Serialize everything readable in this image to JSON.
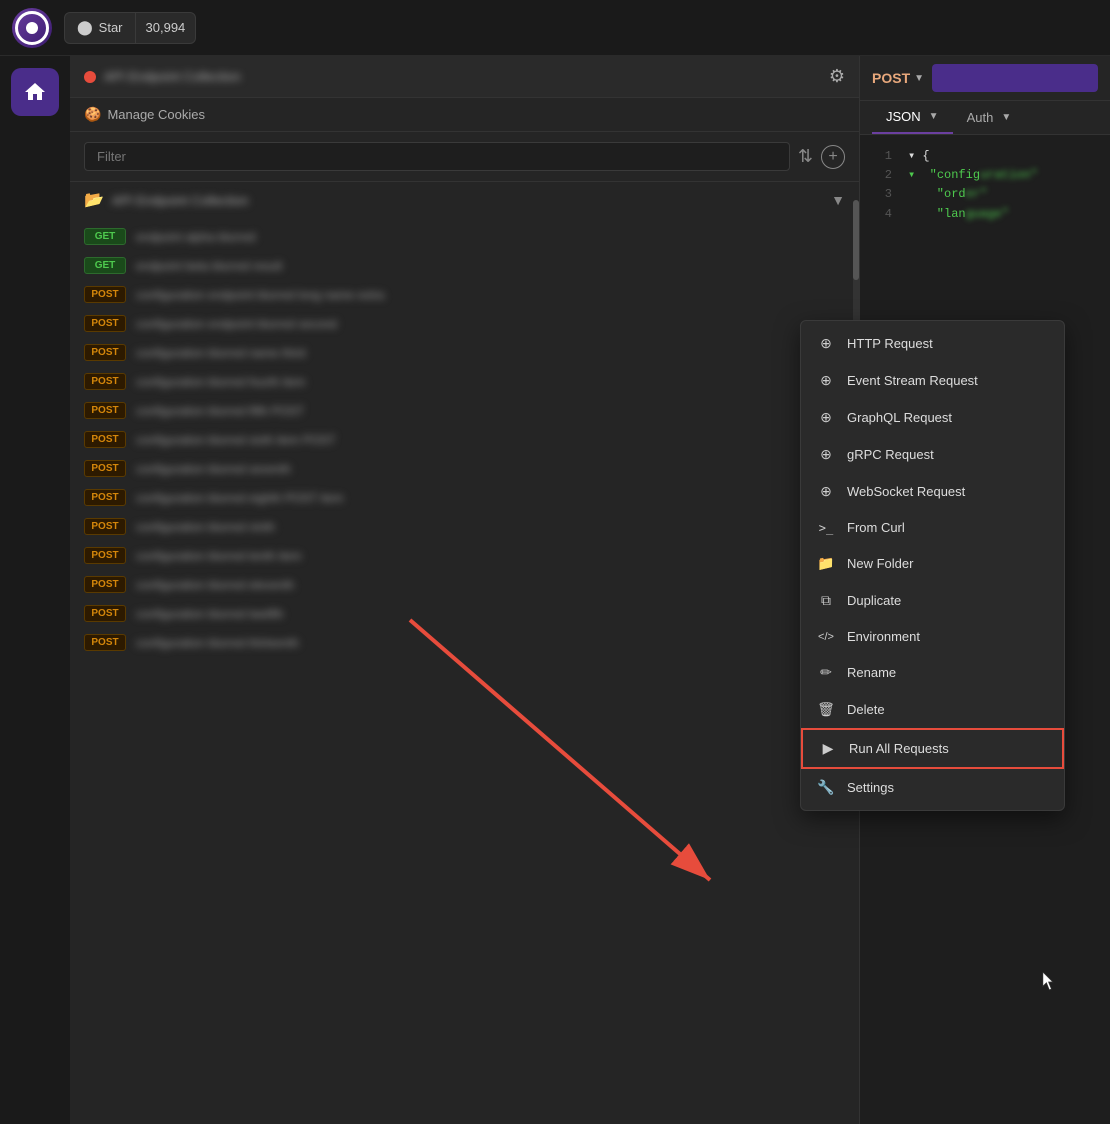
{
  "topbar": {
    "star_label": "Star",
    "star_count": "30,994",
    "github_icon": "github"
  },
  "request_panel": {
    "record_dot": "red",
    "title": "API Endpoint Collection",
    "filter_placeholder": "Filter",
    "manage_cookies": "Manage Cookies",
    "collection_name": "API Endpoint Collection"
  },
  "methods": {
    "get": "GET",
    "post": "POST"
  },
  "right_panel": {
    "method": "POST",
    "tab_json": "JSON",
    "tab_auth": "Auth"
  },
  "dropdown_menu": {
    "items": [
      {
        "id": "http-request",
        "icon": "⊕",
        "label": "HTTP Request"
      },
      {
        "id": "event-stream-request",
        "icon": "⊕",
        "label": "Event Stream Request"
      },
      {
        "id": "graphql-request",
        "icon": "⊕",
        "label": "GraphQL Request"
      },
      {
        "id": "grpc-request",
        "icon": "⊕",
        "label": "gRPC Request"
      },
      {
        "id": "websocket-request",
        "icon": "⊕",
        "label": "WebSocket Request"
      },
      {
        "id": "from-curl",
        "icon": ">_",
        "label": "From Curl"
      },
      {
        "id": "new-folder",
        "icon": "📁",
        "label": "New Folder"
      },
      {
        "id": "duplicate",
        "icon": "⧉",
        "label": "Duplicate"
      },
      {
        "id": "environment",
        "icon": "</>",
        "label": "Environment"
      },
      {
        "id": "rename",
        "icon": "✏",
        "label": "Rename"
      },
      {
        "id": "delete",
        "icon": "🗑",
        "label": "Delete"
      },
      {
        "id": "run-all-requests",
        "icon": "▶",
        "label": "Run All Requests"
      },
      {
        "id": "settings",
        "icon": "🔧",
        "label": "Settings"
      }
    ],
    "highlighted": "run-all-requests"
  },
  "code": {
    "lines": [
      {
        "num": "1",
        "text": "{"
      },
      {
        "num": "2",
        "text": "  \"config"
      },
      {
        "num": "3",
        "text": "    \"ord"
      },
      {
        "num": "4",
        "text": "    \"lan"
      }
    ]
  },
  "requests": [
    {
      "method": "GET",
      "name": "endpoint-one",
      "type": "get"
    },
    {
      "method": "GET",
      "name": "endpoint-two",
      "type": "get"
    },
    {
      "method": "POST",
      "name": "config-post-1",
      "type": "post"
    },
    {
      "method": "POST",
      "name": "config-post-2",
      "type": "post"
    },
    {
      "method": "POST",
      "name": "config-post-3",
      "type": "post"
    },
    {
      "method": "POST",
      "name": "config-post-4",
      "type": "post"
    },
    {
      "method": "POST",
      "name": "config-post-5",
      "type": "post"
    },
    {
      "method": "POST",
      "name": "config-post-6",
      "type": "post"
    },
    {
      "method": "POST",
      "name": "config-post-7",
      "type": "post"
    },
    {
      "method": "POST",
      "name": "config-post-8",
      "type": "post"
    },
    {
      "method": "POST",
      "name": "config-post-9",
      "type": "post"
    },
    {
      "method": "POST",
      "name": "config-post-10",
      "type": "post"
    },
    {
      "method": "POST",
      "name": "config-post-11",
      "type": "post"
    },
    {
      "method": "POST",
      "name": "config-post-12",
      "type": "post"
    },
    {
      "method": "POST",
      "name": "config-post-13",
      "type": "post"
    }
  ]
}
